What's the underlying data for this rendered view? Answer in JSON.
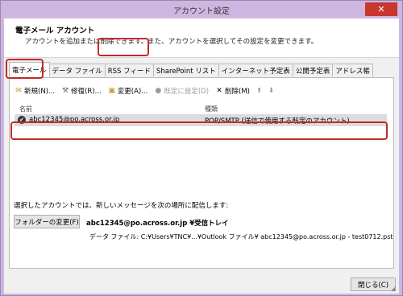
{
  "window": {
    "title": "アカウント設定",
    "close_symbol": "✕"
  },
  "header": {
    "title": "電子メール アカウント",
    "description": "アカウントを追加または削除できます。また、アカウントを選択してその設定を変更できます。"
  },
  "tabs": [
    {
      "label": "電子メール",
      "active": true
    },
    {
      "label": "データ ファイル"
    },
    {
      "label": "RSS フィード"
    },
    {
      "label": "SharePoint リスト"
    },
    {
      "label": "インターネット予定表"
    },
    {
      "label": "公開予定表"
    },
    {
      "label": "アドレス帳"
    }
  ],
  "toolbar": {
    "new_label": "新規(N)...",
    "repair_label": "修復(R)...",
    "change_label": "変更(A)...",
    "default_label": "既定に設定(D)",
    "delete_label": "削除(M)",
    "up_arrow": "⬆",
    "down_arrow": "⬇"
  },
  "columns": {
    "name": "名前",
    "type": "種類"
  },
  "accounts": [
    {
      "name": "abc12345@po.across.or.jp",
      "type": "POP/SMTP (送信で使用する既定のアカウント)"
    }
  ],
  "delivery": {
    "label": "選択したアカウントでは、新しいメッセージを次の場所に配信します:",
    "change_folder_label": "フォルダーの変更(F)",
    "target": "abc12345@po.across.or.jp ¥受信トレイ",
    "data_file": "データ ファイル: C:¥Users¥TNC¥...¥Outlook ファイル¥ abc12345@po.across.or.jp - test0712.pst"
  },
  "footer": {
    "close_label": "閉じる(C)"
  },
  "colors": {
    "highlight": "#c22a2a",
    "titlebar": "#cdb7e0",
    "close_button": "#c8372d"
  }
}
